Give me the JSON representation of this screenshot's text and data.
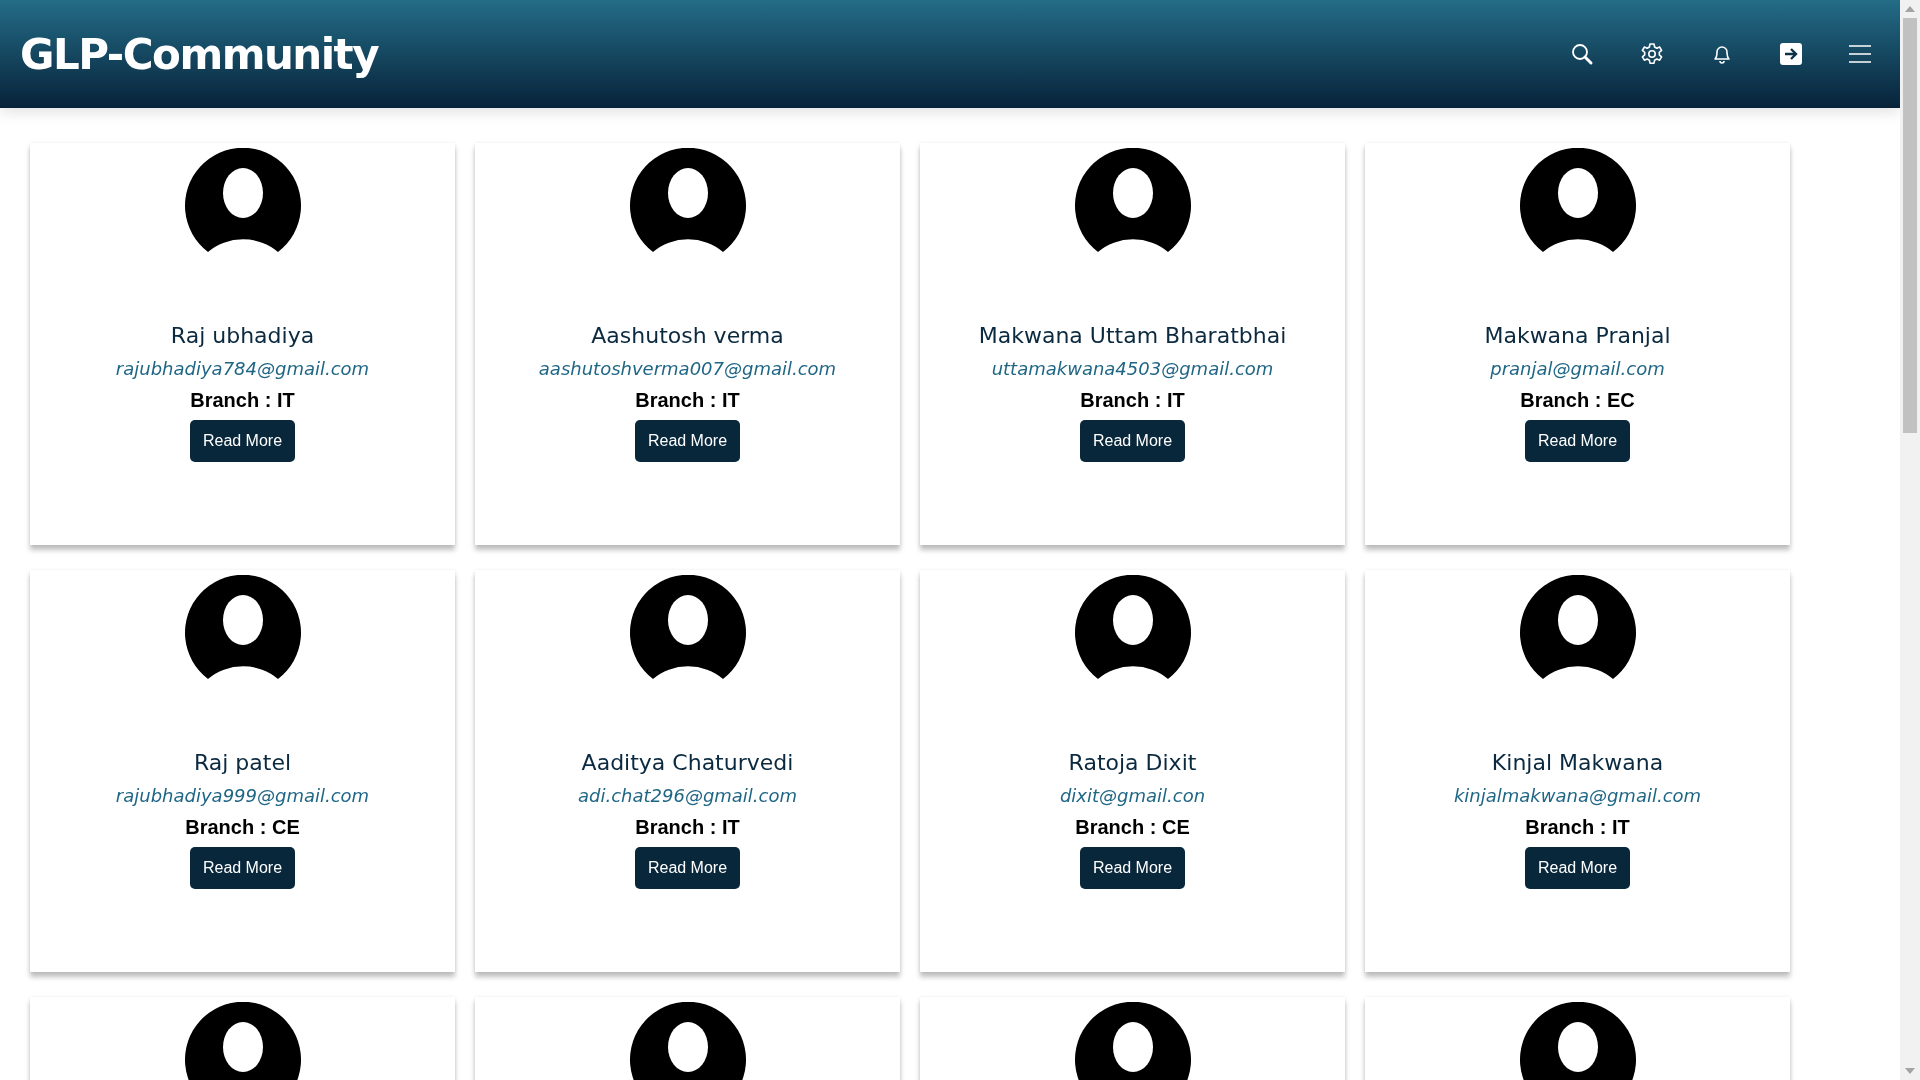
{
  "header": {
    "logo": "GLP-Community"
  },
  "cards": [
    {
      "name": "Raj ubhadiya",
      "email": "rajubhadiya784@gmail.com",
      "branch": "Branch : IT",
      "button": "Read More"
    },
    {
      "name": "Aashutosh verma",
      "email": "aashutoshverma007@gmail.com",
      "branch": "Branch : IT",
      "button": "Read More"
    },
    {
      "name": "Makwana Uttam Bharatbhai",
      "email": "uttamakwana4503@gmail.com",
      "branch": "Branch : IT",
      "button": "Read More"
    },
    {
      "name": "Makwana Pranjal",
      "email": "pranjal@gmail.com",
      "branch": "Branch : EC",
      "button": "Read More"
    },
    {
      "name": "Raj patel",
      "email": "rajubhadiya999@gmail.com",
      "branch": "Branch : CE",
      "button": "Read More"
    },
    {
      "name": "Aaditya Chaturvedi",
      "email": "adi.chat296@gmail.com",
      "branch": "Branch : IT",
      "button": "Read More"
    },
    {
      "name": "Ratoja Dixit",
      "email": "dixit@gmail.con",
      "branch": "Branch : CE",
      "button": "Read More"
    },
    {
      "name": "Kinjal Makwana",
      "email": "kinjalmakwana@gmail.com",
      "branch": "Branch : IT",
      "button": "Read More"
    }
  ],
  "more_cards": [
    {
      "kind": "avatar_only"
    },
    {
      "kind": "avatar_only"
    },
    {
      "kind": "avatar_only"
    },
    {
      "kind": "avatar_only"
    }
  ]
}
